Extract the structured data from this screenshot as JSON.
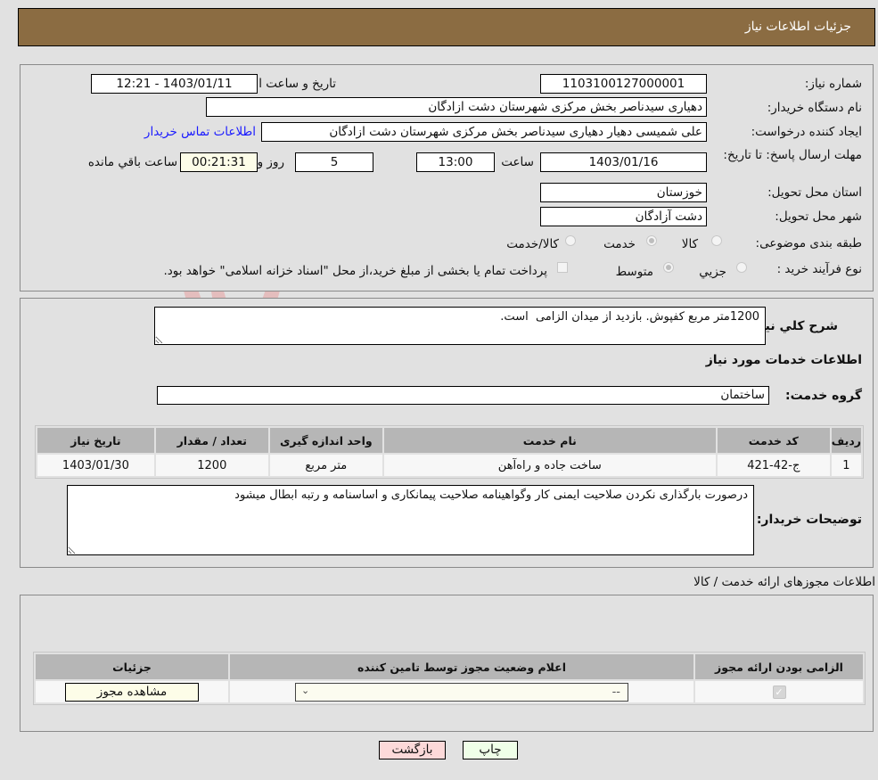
{
  "header": {
    "title": "جزئیات اطلاعات نیاز"
  },
  "watermark": {
    "text": "AriaTender.neT"
  },
  "details": {
    "need_number_label": "شماره نیاز:",
    "need_number": "1103100127000001",
    "announce_label": "تاریخ و ساعت اعلان عمومي:",
    "announce_value": "1403/01/11 - 12:21",
    "buyer_org_label": "نام دستگاه خریدار:",
    "buyer_org": "دهیاری سیدناصر بخش مرکزی شهرستان دشت ازادگان",
    "creator_label": "ایجاد کننده درخواست:",
    "creator": "علی شمیسی دهیار دهیاری سیدناصر بخش مرکزی شهرستان دشت ازادگان",
    "contact_link": "اطلاعات تماس خریدار",
    "deadline_label": "مهلت ارسال پاسخ: تا تاریخ:",
    "deadline_date": "1403/01/16",
    "time_label": "ساعت",
    "deadline_time": "13:00",
    "days_value": "5",
    "days_label": "روز و",
    "remaining_value": "00:21:31",
    "remaining_label": "ساعت باقي مانده",
    "province_label": "استان محل تحویل:",
    "province": "خوزستان",
    "city_label": "شهر محل تحویل:",
    "city": "دشت آزادگان",
    "category_label": "طبقه بندی موضوعی:",
    "category_options": [
      {
        "label": "کالا",
        "selected": false
      },
      {
        "label": "خدمت",
        "selected": true
      },
      {
        "label": "کالا/خدمت",
        "selected": false
      }
    ],
    "process_label": "نوع فرآیند خرید :",
    "process_options": [
      {
        "label": "جزيي",
        "selected": false
      },
      {
        "label": "متوسط",
        "selected": true
      }
    ],
    "treasury_checkbox_label": "پرداخت تمام یا بخشی از مبلغ خرید،از محل \"اسناد خزانه اسلامی\" خواهد بود.",
    "treasury_checked": false
  },
  "services": {
    "summary_label": "شرح کلي نیاز:",
    "summary_text": "1200متر مربع کفپوش. بازدید از میدان الزامی  است.",
    "section_title": "اطلاعات خدمات مورد نیاز",
    "group_label": "گروه خدمت:",
    "group_value": "ساختمان",
    "table": {
      "headers": [
        "ردیف",
        "کد خدمت",
        "نام خدمت",
        "واحد اندازه گیری",
        "تعداد / مقدار",
        "تاریخ نیاز"
      ],
      "rows": [
        [
          "1",
          "ج-42-421",
          "ساخت جاده و راه‌آهن",
          "متر مربع",
          "1200",
          "1403/01/30"
        ]
      ]
    },
    "buyer_notes_label": "توضیحات خریدار:",
    "buyer_notes": "درصورت بارگذاری نکردن صلاحیت ایمنی کار وگواهینامه صلاحیت پیمانکاری و اساسنامه و رتبه ابطال میشود"
  },
  "permits": {
    "section_title": "اطلاعات مجوزهای ارائه خدمت / کالا",
    "headers": [
      "الزامی بودن ارائه مجوز",
      "اعلام وضعیت مجوز توسط تامین کننده",
      "جزئیات"
    ],
    "row": {
      "required_checked": true,
      "status_selected": "--",
      "details_button": "مشاهده مجوز"
    }
  },
  "actions": {
    "print": "چاپ",
    "back": "بازگشت"
  }
}
